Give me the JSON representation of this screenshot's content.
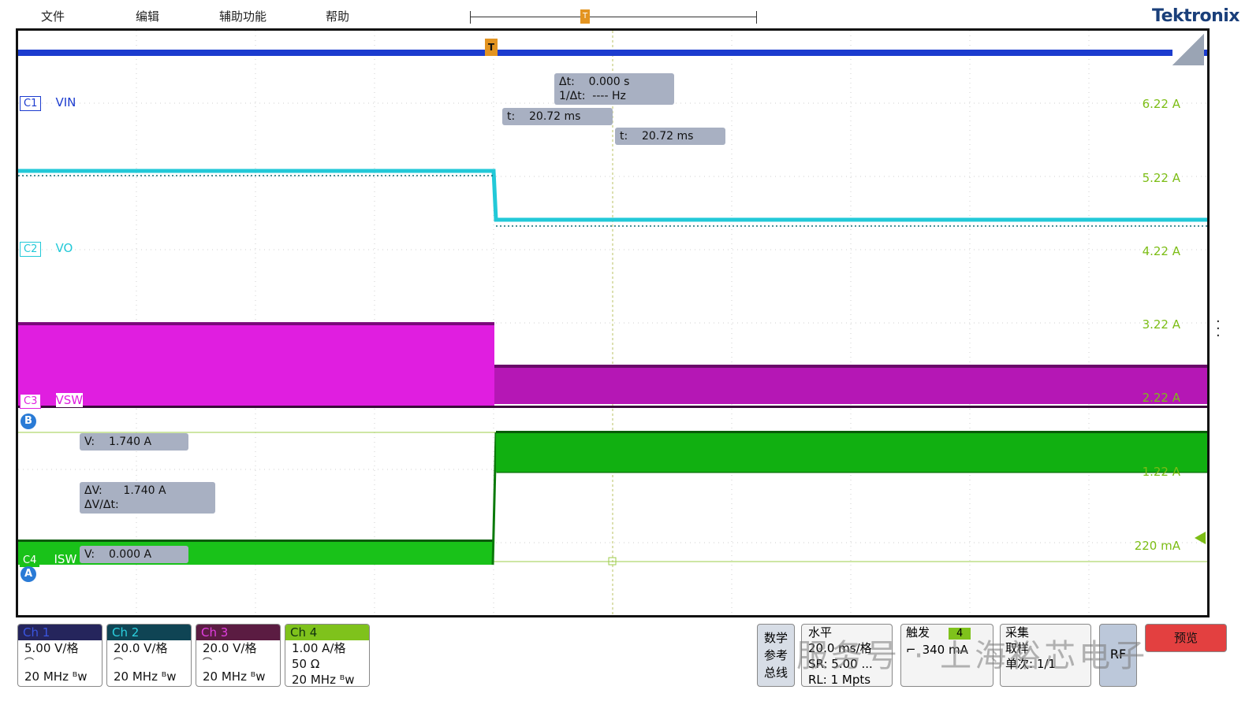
{
  "menu": {
    "file": "文件",
    "edit": "编辑",
    "utilities": "辅助功能",
    "help": "帮助"
  },
  "brand": "Tektronix",
  "trigger_marker": "T",
  "channels": {
    "c1": {
      "tag": "C1",
      "name": "VIN",
      "color": "#1c3ccf"
    },
    "c2": {
      "tag": "C2",
      "name": "VO",
      "color": "#22c9d8"
    },
    "c3": {
      "tag": "C3",
      "name": "VSW",
      "color": "#e01ee0"
    },
    "c4": {
      "tag": "C4",
      "name": "ISW",
      "color": "#19c219"
    }
  },
  "scale_labels": [
    "6.22 A",
    "5.22 A",
    "4.22 A",
    "3.22 A",
    "2.22 A",
    "1.22 A",
    "220 mA"
  ],
  "cursors": {
    "delta_t": "Δt:    0.000 s",
    "inv_delta_t": "1/Δt:  ---- Hz",
    "t1": "t:    20.72 ms",
    "t2": "t:    20.72 ms",
    "v_b": "V:    1.740 A",
    "delta_v": "ΔV:      1.740 A",
    "dv_dt": "ΔV/Δt:",
    "v_a": "V:    0.000 A",
    "b_marker": "B",
    "a_marker": "A"
  },
  "bottom_badges": [
    {
      "head": "Ch 1",
      "head_bg": "#25255c",
      "head_color": "#3a55e0",
      "line1": "5.00 V/格",
      "line2": "⌒",
      "line3": "20 MHz ᴮw"
    },
    {
      "head": "Ch 2",
      "head_bg": "#0f4454",
      "head_color": "#2bd1e0",
      "line1": "20.0 V/格",
      "line2": "⌒",
      "line3": "20 MHz ᴮw"
    },
    {
      "head": "Ch 3",
      "head_bg": "#5b1c42",
      "head_color": "#e23ee0",
      "line1": "20.0 V/格",
      "line2": "⌒",
      "line3": "20 MHz ᴮw"
    },
    {
      "head": "Ch 4",
      "head_bg": "#7fc21c",
      "head_color": "#103010",
      "line1": "1.00 A/格",
      "line2": "50 Ω",
      "line3": "20 MHz ᴮw"
    }
  ],
  "right_panels": {
    "math": [
      "数学",
      "参考",
      "总线"
    ],
    "horizontal": {
      "title": "水平",
      "l1": "20.0 ms/格",
      "l2": "SR: 5.00 ...",
      "l3": "RL: 1 Mpts"
    },
    "trigger": {
      "title": "触发",
      "ch": "4",
      "level": "340 mA"
    },
    "acquire": {
      "title": "采集",
      "l1": "取样",
      "l2": "单次: 1/1"
    },
    "rf": "RF",
    "preview": "预览"
  },
  "watermark": "服务号 · 上海裕芯电子"
}
